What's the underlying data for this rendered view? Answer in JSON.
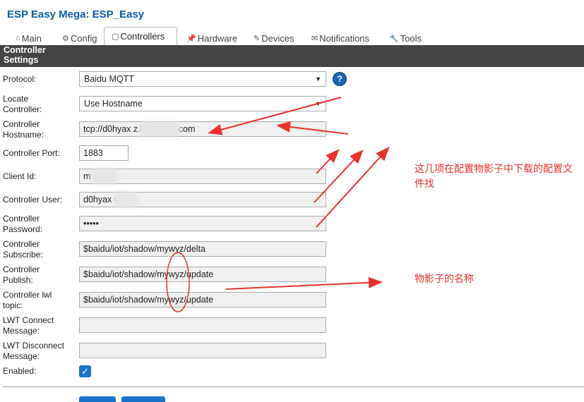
{
  "app": {
    "title": "ESP Easy Mega: ESP_Easy"
  },
  "tabs": [
    {
      "label": "Main",
      "icon": "home-icon"
    },
    {
      "label": "Config",
      "icon": "gear-icon"
    },
    {
      "label": "Controllers",
      "icon": "chat-icon",
      "active": true
    },
    {
      "label": "Hardware",
      "icon": "pin-icon"
    },
    {
      "label": "Devices",
      "icon": "plug-icon"
    },
    {
      "label": "Notifications",
      "icon": "mail-icon"
    },
    {
      "label": "Tools",
      "icon": "wrench-icon"
    }
  ],
  "section": {
    "title": "Controller Settings"
  },
  "form": {
    "protocol": {
      "label": "Protocol:",
      "value": "Baidu MQTT",
      "help": "?"
    },
    "locate": {
      "label": "Locate Controller:",
      "value": "Use Hostname"
    },
    "hostname": {
      "label": "Controller Hostname:",
      "value": "tcp://d0hyax                 z.baidubce.com"
    },
    "port": {
      "label": "Controller Port:",
      "value": "1883"
    },
    "client_id": {
      "label": "Client Id:",
      "value": "m"
    },
    "user": {
      "label": "Controller User:",
      "value": "d0hyax            vyz"
    },
    "password": {
      "label": "Controller Password:",
      "value": "•••••"
    },
    "subscribe": {
      "label": "Controller Subscribe:",
      "value": "$baidu/iot/shadow/mywyz/delta"
    },
    "publish": {
      "label": "Controller Publish:",
      "value": "$baidu/iot/shadow/mywyz/update"
    },
    "lwl_topic": {
      "label": "Controller lwl topic:",
      "value": "$baidu/iot/shadow/mywyz/update"
    },
    "lwt_connect": {
      "label": "LWT Connect Message:",
      "value": ""
    },
    "lwt_disconnect": {
      "label": "LWT Disconnect Message:",
      "value": ""
    },
    "enabled": {
      "label": "Enabled:",
      "checked": true,
      "check_glyph": "✓"
    }
  },
  "annotations": {
    "note1": "这几项在配置物影子中下载的配置文件找",
    "note2": "物影子的名称",
    "color": "#e8322e"
  }
}
